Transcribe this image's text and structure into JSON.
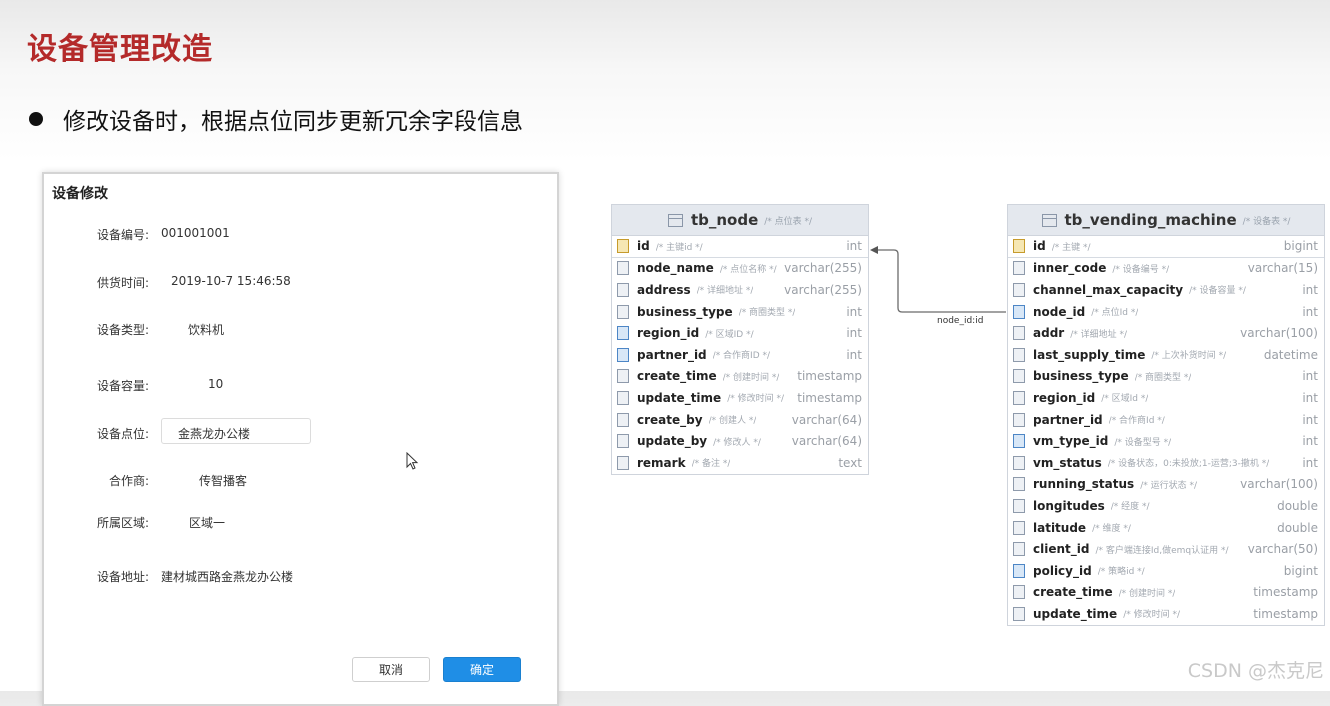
{
  "slide": {
    "title": "设备管理改造",
    "bullet": "修改设备时，根据点位同步更新冗余字段信息"
  },
  "dialog": {
    "title": "设备修改",
    "fields": [
      {
        "label": "设备编号:",
        "value": "001001001"
      },
      {
        "label": "供货时间:",
        "value": "2019-10-7 15:46:58"
      },
      {
        "label": "设备类型:",
        "value": "饮料机"
      },
      {
        "label": "设备容量:",
        "value": "10"
      },
      {
        "label": "设备点位:",
        "value": "金燕龙办公楼"
      },
      {
        "label": "合作商:",
        "value": "传智播客"
      },
      {
        "label": "所属区域:",
        "value": "区域一"
      },
      {
        "label": "设备地址:",
        "value": "建材城西路金燕龙办公楼"
      }
    ],
    "cancel_label": "取消",
    "ok_label": "确定"
  },
  "tb_node": {
    "name": "tb_node",
    "comment": "/* 点位表 */",
    "columns": [
      {
        "name": "id",
        "comment": "/* 主键id */",
        "type": "int",
        "key": "pk"
      },
      {
        "name": "node_name",
        "comment": "/* 点位名称 */",
        "type": "varchar(255)",
        "key": ""
      },
      {
        "name": "address",
        "comment": "/* 详细地址 */",
        "type": "varchar(255)",
        "key": ""
      },
      {
        "name": "business_type",
        "comment": "/* 商圈类型 */",
        "type": "int",
        "key": ""
      },
      {
        "name": "region_id",
        "comment": "/* 区域ID */",
        "type": "int",
        "key": "fk"
      },
      {
        "name": "partner_id",
        "comment": "/* 合作商ID */",
        "type": "int",
        "key": "fk"
      },
      {
        "name": "create_time",
        "comment": "/* 创建时间 */",
        "type": "timestamp",
        "key": ""
      },
      {
        "name": "update_time",
        "comment": "/* 修改时间 */",
        "type": "timestamp",
        "key": ""
      },
      {
        "name": "create_by",
        "comment": "/* 创建人 */",
        "type": "varchar(64)",
        "key": ""
      },
      {
        "name": "update_by",
        "comment": "/* 修改人 */",
        "type": "varchar(64)",
        "key": ""
      },
      {
        "name": "remark",
        "comment": "/* 备注 */",
        "type": "text",
        "key": ""
      }
    ]
  },
  "tb_vending_machine": {
    "name": "tb_vending_machine",
    "comment": "/* 设备表 */",
    "columns": [
      {
        "name": "id",
        "comment": "/* 主键 */",
        "type": "bigint",
        "key": "pk"
      },
      {
        "name": "inner_code",
        "comment": "/* 设备编号 */",
        "type": "varchar(15)",
        "key": ""
      },
      {
        "name": "channel_max_capacity",
        "comment": "/* 设备容量 */",
        "type": "int",
        "key": ""
      },
      {
        "name": "node_id",
        "comment": "/* 点位Id */",
        "type": "int",
        "key": "fk"
      },
      {
        "name": "addr",
        "comment": "/* 详细地址 */",
        "type": "varchar(100)",
        "key": ""
      },
      {
        "name": "last_supply_time",
        "comment": "/* 上次补货时间 */",
        "type": "datetime",
        "key": ""
      },
      {
        "name": "business_type",
        "comment": "/* 商圈类型 */",
        "type": "int",
        "key": ""
      },
      {
        "name": "region_id",
        "comment": "/* 区域Id */",
        "type": "int",
        "key": ""
      },
      {
        "name": "partner_id",
        "comment": "/* 合作商Id */",
        "type": "int",
        "key": ""
      },
      {
        "name": "vm_type_id",
        "comment": "/* 设备型号 */",
        "type": "int",
        "key": "fk"
      },
      {
        "name": "vm_status",
        "comment": "/* 设备状态，0:未投放;1-运营;3-撤机 */",
        "type": "int",
        "key": ""
      },
      {
        "name": "running_status",
        "comment": "/* 运行状态 */",
        "type": "varchar(100)",
        "key": ""
      },
      {
        "name": "longitudes",
        "comment": "/* 经度 */",
        "type": "double",
        "key": ""
      },
      {
        "name": "latitude",
        "comment": "/* 维度 */",
        "type": "double",
        "key": ""
      },
      {
        "name": "client_id",
        "comment": "/* 客户端连接Id,做emq认证用 */",
        "type": "varchar(50)",
        "key": ""
      },
      {
        "name": "policy_id",
        "comment": "/* 策略id */",
        "type": "bigint",
        "key": "fk"
      },
      {
        "name": "create_time",
        "comment": "/* 创建时间 */",
        "type": "timestamp",
        "key": ""
      },
      {
        "name": "update_time",
        "comment": "/* 修改时间 */",
        "type": "timestamp",
        "key": ""
      }
    ]
  },
  "relation_label": "node_id:id",
  "watermark": "CSDN @杰克尼"
}
